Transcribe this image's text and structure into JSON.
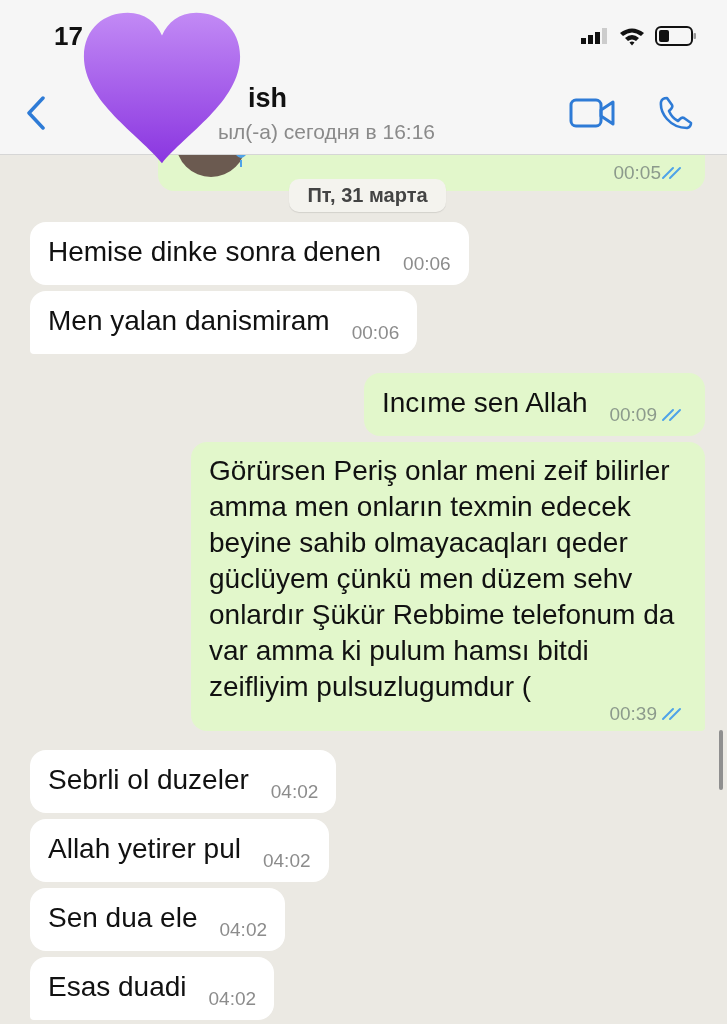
{
  "status_bar": {
    "time": "17"
  },
  "header": {
    "name": "ish",
    "status": "ыл(-а) сегодня в 16:16"
  },
  "voice_message": {
    "time": "00:05",
    "read": true
  },
  "date_pill": "Пт, 31 марта",
  "messages": [
    {
      "kind": "in",
      "text": "Hemise dinke sonra denen",
      "time": "00:06",
      "tail": false
    },
    {
      "kind": "in",
      "text": "Men yalan danismiram",
      "time": "00:06",
      "tail": true
    },
    {
      "kind": "out",
      "text": "Incıme sen Allah",
      "time": "00:09",
      "read": true,
      "tail": false
    },
    {
      "kind": "out",
      "text": "Görürsen Periş onlar meni zeif bilirler amma men onların texmin edecek beyine sahib olmayacaqları qeder güclüyem çünkü men düzem sehv onlardır Şükür Rebbime telefonum da var amma ki pulum hamsı bitdi zeifliyim pulsuzlugumdur (",
      "time": "00:39",
      "read": true,
      "tail": true
    },
    {
      "kind": "in",
      "text": "Sebrli ol duzeler",
      "time": "04:02",
      "tail": false
    },
    {
      "kind": "in",
      "text": "Allah yetirer pul",
      "time": "04:02",
      "tail": false
    },
    {
      "kind": "in",
      "text": "Sen dua ele",
      "time": "04:02",
      "tail": false
    },
    {
      "kind": "in",
      "text": "Esas duadi",
      "time": "04:02",
      "tail": true
    }
  ]
}
